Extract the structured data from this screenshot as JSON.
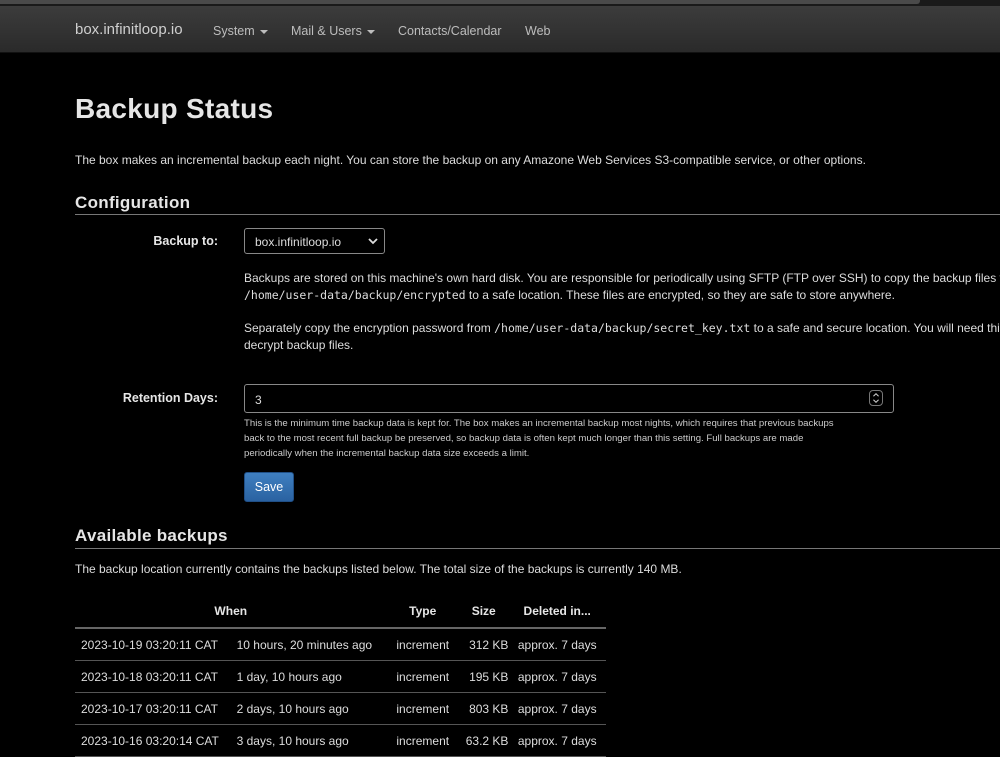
{
  "navbar": {
    "brand": "box.infinitloop.io",
    "items": [
      "System",
      "Mail & Users",
      "Contacts/Calendar",
      "Web"
    ]
  },
  "page": {
    "title": "Backup Status",
    "intro": "The box makes an incremental backup each night. You can store the backup on any Amazone Web Services S3-compatible service, or other options."
  },
  "config": {
    "heading": "Configuration",
    "backup_to_label": "Backup to:",
    "backup_to_value": "box.infinitloop.io",
    "desc1_a": "Backups are stored on this machine's own hard disk. You are responsible for periodically using SFTP (FTP over SSH) to copy the backup files from",
    "desc1_path": "/home/user-data/backup/encrypted",
    "desc1_b": " to a safe location. These files are encrypted, so they are safe to store anywhere.",
    "desc2_a": "Separately copy the encryption password from ",
    "desc2_path": "/home/user-data/backup/secret_key.txt",
    "desc2_b": " to a safe and secure location. You will need this file to",
    "desc2_c": "decrypt backup files.",
    "retention_label": "Retention Days:",
    "retention_value": "3",
    "help_line1": "This is the minimum time backup data is kept for. The box makes an incremental backup most nights, which requires that previous backups",
    "help_line2": "back to the most recent full backup be preserved, so backup data is often kept much longer than this setting. Full backups are made",
    "help_line3": "periodically when the incremental backup data size exceeds a limit.",
    "save_label": "Save"
  },
  "backups": {
    "heading": "Available backups",
    "summary": "The backup location currently contains the backups listed below. The total size of the backups is currently 140 MB.",
    "columns": [
      "When",
      "Type",
      "Size",
      "Deleted in..."
    ],
    "rows": [
      {
        "date": "2023-10-19 03:20:11 CAT",
        "ago": "10 hours, 20 minutes ago",
        "type": "increment",
        "size": "312 KB",
        "deleted": "approx. 7 days"
      },
      {
        "date": "2023-10-18 03:20:11 CAT",
        "ago": "1 day, 10 hours ago",
        "type": "increment",
        "size": "195 KB",
        "deleted": "approx. 7 days"
      },
      {
        "date": "2023-10-17 03:20:11 CAT",
        "ago": "2 days, 10 hours ago",
        "type": "increment",
        "size": "803 KB",
        "deleted": "approx. 7 days"
      },
      {
        "date": "2023-10-16 03:20:14 CAT",
        "ago": "3 days, 10 hours ago",
        "type": "increment",
        "size": "63.2 KB",
        "deleted": "approx. 7 days"
      }
    ]
  }
}
